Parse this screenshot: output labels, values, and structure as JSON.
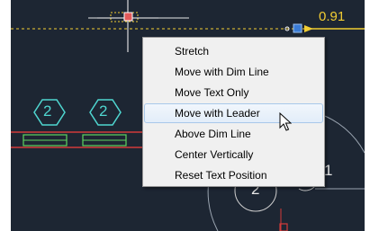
{
  "dimension": {
    "value": "0.91"
  },
  "tags": {
    "hex_left": "2",
    "hex_right": "2",
    "circle_bottom": "2",
    "circle_right": "1"
  },
  "context_menu": {
    "items": [
      {
        "label": "Stretch",
        "highlighted": false
      },
      {
        "label": "Move with Dim Line",
        "highlighted": false
      },
      {
        "label": "Move Text Only",
        "highlighted": false
      },
      {
        "label": "Move with Leader",
        "highlighted": true
      },
      {
        "label": "Above Dim Line",
        "highlighted": false
      },
      {
        "label": "Center Vertically",
        "highlighted": false
      },
      {
        "label": "Reset Text Position",
        "highlighted": false
      }
    ]
  },
  "colors": {
    "background": "#1d2633",
    "dimension": "#f2cd33",
    "tag": "#4fd6d0",
    "grip": "#3a7bd5",
    "wall": "#d23a3a",
    "highlight_border": "#a8c8ea"
  },
  "icons": {
    "pointer": "arrow-cursor-icon",
    "crosshair": "crosshair-icon",
    "grip": "grip-icon"
  }
}
